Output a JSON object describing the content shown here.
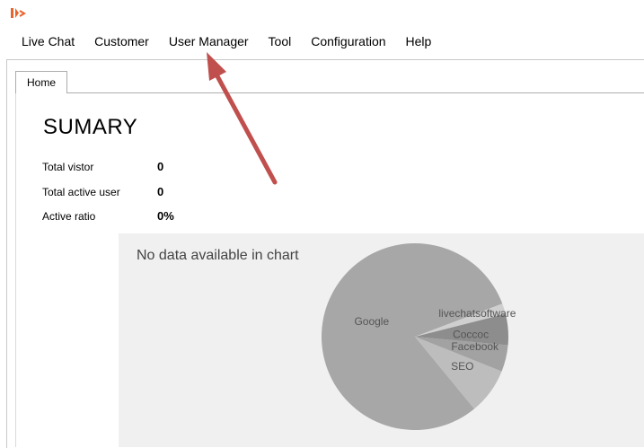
{
  "menu": {
    "items": [
      {
        "label": "Live Chat"
      },
      {
        "label": "Customer"
      },
      {
        "label": "User Manager"
      },
      {
        "label": "Tool"
      },
      {
        "label": "Configuration"
      },
      {
        "label": "Help"
      }
    ]
  },
  "tabs": [
    {
      "label": "Home",
      "active": true
    }
  ],
  "summary": {
    "title": "SUMARY",
    "stats": [
      {
        "label": "Total vistor",
        "value": "0"
      },
      {
        "label": "Total active user",
        "value": "0"
      },
      {
        "label": "Active ratio",
        "value": "0%"
      }
    ]
  },
  "chart": {
    "message": "No data available in chart"
  },
  "chart_data": {
    "type": "pie",
    "slices": [
      {
        "label": "Google",
        "value": 80.2,
        "color": "#a7a7a7"
      },
      {
        "label": "SEO",
        "value": 8.0,
        "color": "#bdbdbd"
      },
      {
        "label": "Facebook",
        "value": 4.6,
        "color": "#a2a2a2"
      },
      {
        "label": "Coccoc",
        "value": 5.4,
        "color": "#8d8d8d"
      },
      {
        "label": "livechatsoftware",
        "value": 1.8,
        "color": "#cfcfcf"
      }
    ]
  },
  "colors": {
    "annotation_arrow": "#c0504d",
    "logo": "#e8642c"
  }
}
